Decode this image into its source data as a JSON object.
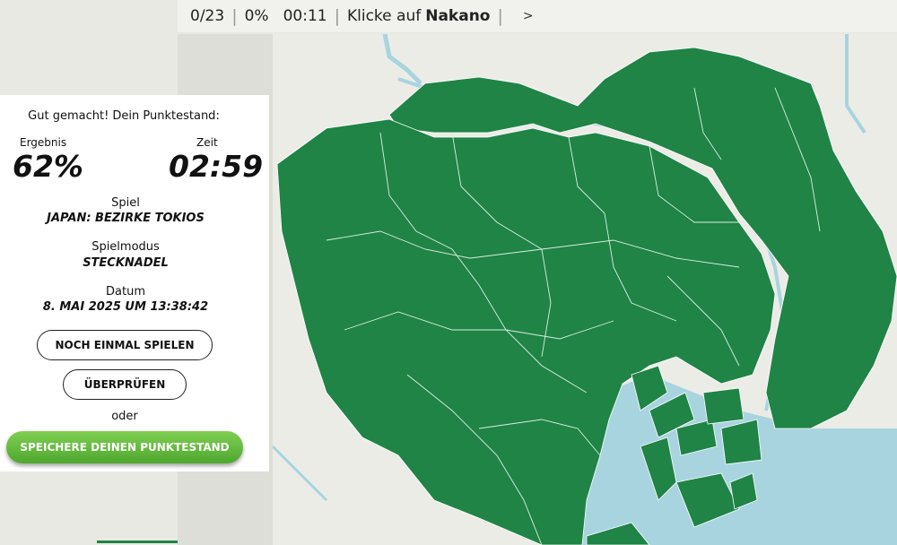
{
  "status_bar": {
    "found": "0/23",
    "percent": "0%",
    "timer": "00:11",
    "prompt": "Klicke auf",
    "target": "Nakano",
    "next": ">"
  },
  "result": {
    "heading": "Gut gemacht! Dein Punktestand:",
    "score_label": "Ergebnis",
    "score_value": "62%",
    "time_label": "Zeit",
    "time_value": "02:59",
    "game_label": "Spiel",
    "game_value": "JAPAN: BEZIRKE TOKIOS",
    "mode_label": "Spielmodus",
    "mode_value": "STECKNADEL",
    "date_label": "Datum",
    "date_value": "8. MAI 2025 UM 13:38:42",
    "play_again": "NOCH EINMAL SPIELEN",
    "review": "ÜBERPRÜFEN",
    "or": "oder",
    "save": "SPEICHERE DEINEN PUNKTESTAND"
  },
  "colors": {
    "region_fill": "#1f8446",
    "water": "#a8d4e0",
    "background": "#ecece7",
    "save_button": "#5cb53a"
  }
}
